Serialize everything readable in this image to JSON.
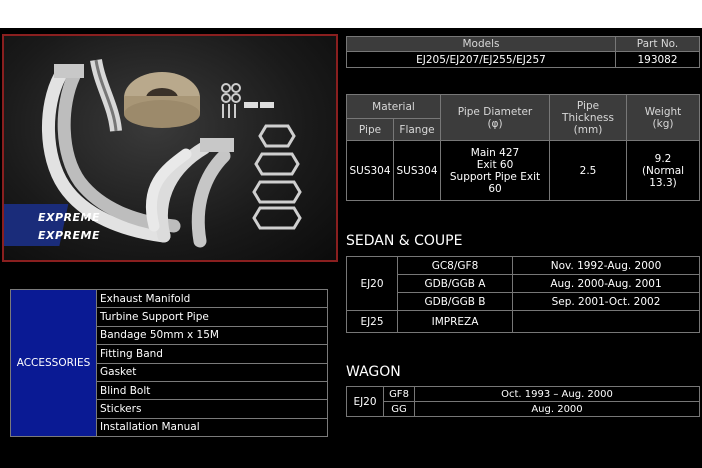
{
  "models_table": {
    "headers": [
      "Models",
      "Part No."
    ],
    "row": [
      "EJ205/EJ207/EJ255/EJ257",
      "193082"
    ]
  },
  "spec_table": {
    "material_header": "Material",
    "pipe_header": "Pipe",
    "flange_header": "Flange",
    "diameter_header": "Pipe Diameter",
    "diameter_unit": "(φ)",
    "thickness_header": "Pipe Thickness",
    "thickness_unit": "(mm)",
    "weight_header": "Weight",
    "weight_unit": "(kg)",
    "pipe": "SUS304",
    "flange": "SUS304",
    "diameter_lines": [
      "Main 427",
      "Exit 60",
      "Support Pipe Exit",
      "60"
    ],
    "thickness": "2.5",
    "weight_lines": [
      "9.2",
      "(Normal",
      "13.3)"
    ]
  },
  "sedan": {
    "title": "SEDAN & COUPE",
    "rows": [
      {
        "engine": "EJ20",
        "model": "GC8/GF8",
        "date": "Nov. 1992-Aug. 2000"
      },
      {
        "engine": "",
        "model": "GDB/GGB  A",
        "date": "Aug. 2000-Aug. 2001"
      },
      {
        "engine": "",
        "model": "GDB/GGB  B",
        "date": "Sep. 2001-Oct. 2002"
      },
      {
        "engine": "EJ25",
        "model": "IMPREZA",
        "date": ""
      }
    ]
  },
  "wagon": {
    "title": "WAGON",
    "engine": "EJ20",
    "rows": [
      {
        "model": "GF8",
        "date": "Oct. 1993 – Aug. 2000"
      },
      {
        "model": "GG",
        "date": "Aug. 2000"
      }
    ]
  },
  "accessories": {
    "label": "ACCESSORIES",
    "items": [
      "Exhaust Manifold",
      "Turbine Support Pipe",
      "Bandage 50mm x 15M",
      "Fitting Band",
      "Gasket",
      "Blind Bolt",
      "Stickers",
      "Installation Manual"
    ]
  },
  "logo": {
    "line1": "EXPREME",
    "line2": "EXPREME"
  }
}
